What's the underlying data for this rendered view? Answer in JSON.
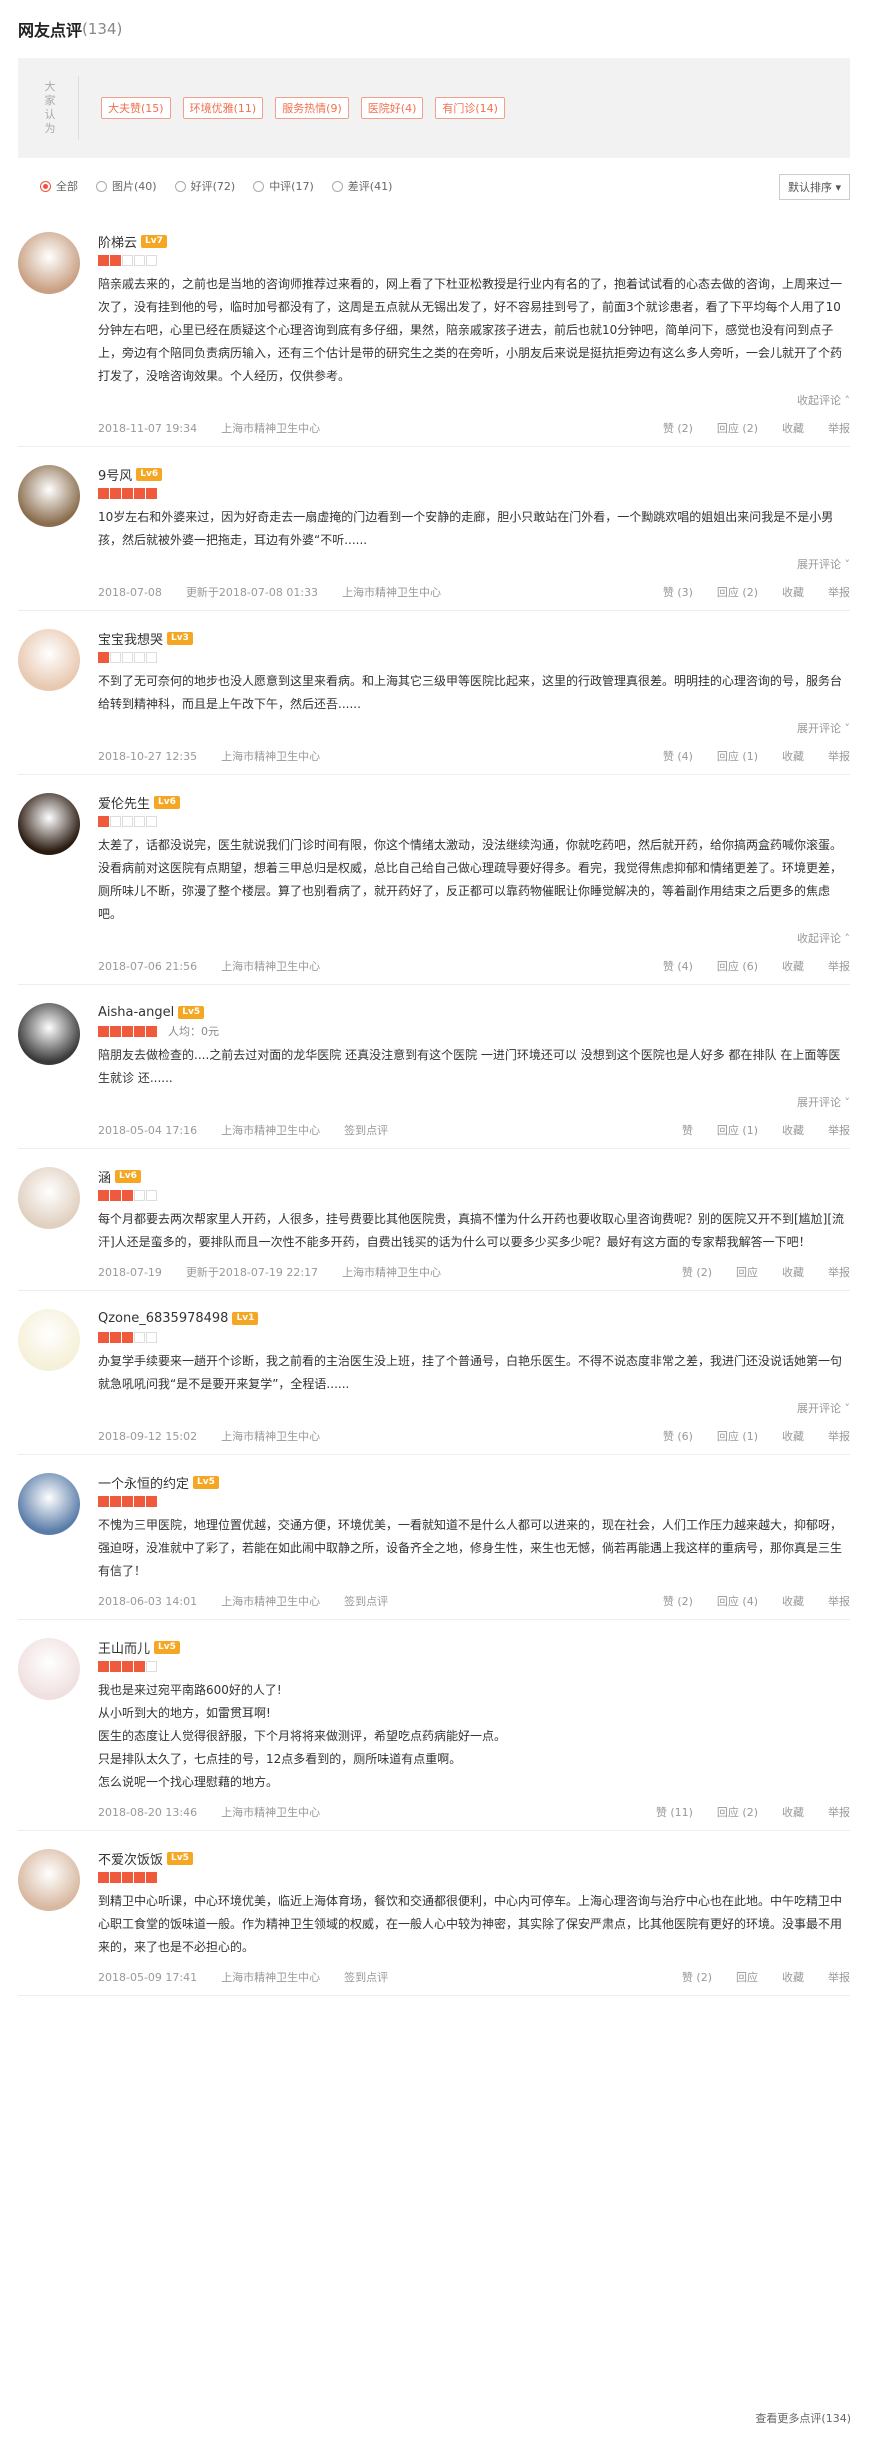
{
  "header": {
    "title": "网友点评",
    "count": "(134)"
  },
  "tags": {
    "label": "大家认为",
    "items": [
      "大夫赞(15)",
      "环境优雅(11)",
      "服务热情(9)",
      "医院好(4)",
      "有门诊(14)"
    ]
  },
  "filter": {
    "options": [
      "全部",
      "图片(40)",
      "好评(72)",
      "中评(17)",
      "差评(41)"
    ],
    "sort": "默认排序"
  },
  "colors": {
    "accent": "#f05a3c",
    "level": "#f5a623"
  },
  "reviews": [
    {
      "name": "阶梯云",
      "level": "Lv7",
      "stars": 2,
      "price": "",
      "text": "陪亲戚去来的，之前也是当地的咨询师推荐过来看的，网上看了下杜亚松教授是行业内有名的了，抱着试试看的心态去做的咨询，上周来过一次了，没有挂到他的号，临时加号都没有了，这周是五点就从无锡出发了，好不容易挂到号了，前面3个就诊患者，看了下平均每个人用了10分钟左右吧，心里已经在质疑这个心理咨询到底有多仔细，果然，陪亲戚家孩子进去，前后也就10分钟吧，简单问下，感觉也没有问到点子上，旁边有个陪同负责病历输入，还有三个估计是带的研究生之类的在旁听，小朋友后来说是挺抗拒旁边有这么多人旁听，一会儿就开了个药打发了，没啥咨询效果。个人经历，仅供参考。",
      "fold": "收起评论",
      "date": "2018-11-07 19:34",
      "updated": "",
      "hospital": "上海市精神卫生中心",
      "checkin": "",
      "like": "赞 (2)",
      "reply": "回应 (2)",
      "fav": "收藏",
      "report": "举报"
    },
    {
      "name": "9号风",
      "level": "Lv6",
      "stars": 5,
      "price": "",
      "text": "10岁左右和外婆来过，因为好奇走去一扇虚掩的门边看到一个安静的走廊，胆小只敢站在门外看，一个黝跳欢唱的姐姐出来问我是不是小男孩，然后就被外婆一把拖走，耳边有外婆“不听......",
      "fold": "展开评论",
      "date": "2018-07-08",
      "updated": "更新于2018-07-08 01:33",
      "hospital": "上海市精神卫生中心",
      "checkin": "",
      "like": "赞 (3)",
      "reply": "回应 (2)",
      "fav": "收藏",
      "report": "举报"
    },
    {
      "name": "宝宝我想哭",
      "level": "Lv3",
      "stars": 1,
      "price": "",
      "text": "不到了无可奈何的地步也没人愿意到这里来看病。和上海其它三级甲等医院比起来，这里的行政管理真很差。明明挂的心理咨询的号，服务台给转到精神科，而且是上午改下午，然后还吾......",
      "fold": "展开评论",
      "date": "2018-10-27 12:35",
      "updated": "",
      "hospital": "上海市精神卫生中心",
      "checkin": "",
      "like": "赞 (4)",
      "reply": "回应 (1)",
      "fav": "收藏",
      "report": "举报"
    },
    {
      "name": "爱伦先生",
      "level": "Lv6",
      "stars": 1,
      "price": "",
      "text": "太差了，话都没说完，医生就说我们门诊时间有限，你这个情绪太激动，没法继续沟通，你就吃药吧，然后就开药，给你搞两盒药喊你滚蛋。没看病前对这医院有点期望，想着三甲总归是权威，总比自己给自己做心理疏导要好得多。看完，我觉得焦虑抑郁和情绪更差了。环境更差，厕所味儿不断，弥漫了整个楼层。算了也别看病了，就开药好了，反正都可以靠药物催眠让你睡觉解决的，等着副作用结束之后更多的焦虑吧。",
      "fold": "收起评论",
      "date": "2018-07-06 21:56",
      "updated": "",
      "hospital": "上海市精神卫生中心",
      "checkin": "",
      "like": "赞 (4)",
      "reply": "回应 (6)",
      "fav": "收藏",
      "report": "举报"
    },
    {
      "name": "Aisha-angel",
      "level": "Lv5",
      "stars": 5,
      "price": "人均：0元",
      "text": "陪朋友去做检查的....之前去过对面的龙华医院 还真没注意到有这个医院 一进门环境还可以 没想到这个医院也是人好多 都在排队 在上面等医生就诊 还......",
      "fold": "展开评论",
      "date": "2018-05-04 17:16",
      "updated": "",
      "hospital": "上海市精神卫生中心",
      "checkin": "签到点评",
      "like": "赞",
      "reply": "回应 (1)",
      "fav": "收藏",
      "report": "举报"
    },
    {
      "name": "涵",
      "level": "Lv6",
      "stars": 3,
      "price": "",
      "text": "每个月都要去两次帮家里人开药，人很多，挂号费要比其他医院贵，真搞不懂为什么开药也要收取心里咨询费呢？别的医院又开不到[尴尬][流汗]人还是蛮多的，要排队而且一次性不能多开药，自费出钱买的话为什么可以要多少买多少呢？最好有这方面的专家帮我解答一下吧！",
      "fold": "",
      "date": "2018-07-19",
      "updated": "更新于2018-07-19 22:17",
      "hospital": "上海市精神卫生中心",
      "checkin": "",
      "like": "赞 (2)",
      "reply": "回应",
      "fav": "收藏",
      "report": "举报"
    },
    {
      "name": "Qzone_6835978498",
      "level": "Lv1",
      "stars": 3,
      "price": "",
      "text": "办复学手续要来一趟开个诊断，我之前看的主治医生没上班，挂了个普通号，白艳乐医生。不得不说态度非常之差，我进门还没说话她第一句就急吼吼问我“是不是要开来复学”，全程语......",
      "fold": "展开评论",
      "date": "2018-09-12 15:02",
      "updated": "",
      "hospital": "上海市精神卫生中心",
      "checkin": "",
      "like": "赞 (6)",
      "reply": "回应 (1)",
      "fav": "收藏",
      "report": "举报"
    },
    {
      "name": "一个永恒的约定",
      "level": "Lv5",
      "stars": 5,
      "price": "",
      "text": "不愧为三甲医院，地理位置优越，交通方便，环境优美，一看就知道不是什么人都可以进来的，现在社会，人们工作压力越来越大，抑郁呀，强迫呀，没准就中了彩了，若能在如此闹中取静之所，设备齐全之地，修身生性，来生也无憾，倘若再能遇上我这样的重病号，那你真是三生有信了！",
      "fold": "",
      "date": "2018-06-03 14:01",
      "updated": "",
      "hospital": "上海市精神卫生中心",
      "checkin": "签到点评",
      "like": "赞 (2)",
      "reply": "回应 (4)",
      "fav": "收藏",
      "report": "举报"
    },
    {
      "name": "王山而儿",
      "level": "Lv5",
      "stars": 4,
      "price": "",
      "text": "我也是来过宛平南路600好的人了!\n从小听到大的地方，如雷贯耳啊!\n医生的态度让人觉得很舒服，下个月将将来做测评，希望吃点药病能好一点。\n只是排队太久了，七点挂的号，12点多看到的，厕所味道有点重啊。\n怎么说呢一个找心理慰藉的地方。",
      "fold": "",
      "date": "2018-08-20 13:46",
      "updated": "",
      "hospital": "上海市精神卫生中心",
      "checkin": "",
      "like": "赞 (11)",
      "reply": "回应 (2)",
      "fav": "收藏",
      "report": "举报"
    },
    {
      "name": "不爱次饭饭",
      "level": "Lv5",
      "stars": 5,
      "price": "",
      "text": "到精卫中心听课，中心环境优美，临近上海体育场，餐饮和交通都很便利，中心内可停车。上海心理咨询与治疗中心也在此地。中午吃精卫中心职工食堂的饭味道一般。作为精神卫生领域的权威，在一般人心中较为神密，其实除了保安严肃点，比其他医院有更好的环境。没事最不用来的，来了也是不必担心的。",
      "fold": "",
      "date": "2018-05-09 17:41",
      "updated": "",
      "hospital": "上海市精神卫生中心",
      "checkin": "签到点评",
      "like": "赞 (2)",
      "reply": "回应",
      "fav": "收藏",
      "report": "举报"
    }
  ],
  "footer": {
    "more": "查看更多点评(134)"
  }
}
